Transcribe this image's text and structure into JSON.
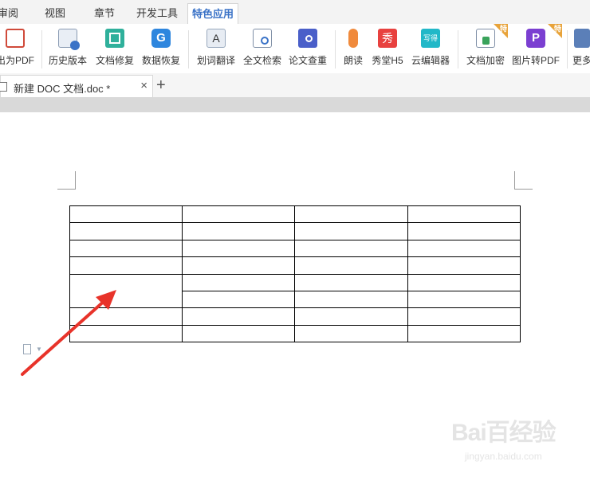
{
  "menu": {
    "tabs": [
      {
        "label": "审阅"
      },
      {
        "label": "视图"
      },
      {
        "label": "章节"
      },
      {
        "label": "开发工具"
      },
      {
        "label": "特色应用"
      }
    ],
    "active_tab": "特色应用"
  },
  "ribbon": {
    "buttons": [
      {
        "label": "出为PDF",
        "icon": "pdf-export-icon"
      },
      {
        "label": "历史版本",
        "icon": "history-icon"
      },
      {
        "label": "文档修复",
        "icon": "doc-repair-icon"
      },
      {
        "label": "数据恢复",
        "icon": "data-recovery-icon"
      },
      {
        "label": "划词翻译",
        "icon": "translate-icon"
      },
      {
        "label": "全文检索",
        "icon": "search-doc-icon"
      },
      {
        "label": "论文查重",
        "icon": "plagiarism-check-icon"
      },
      {
        "label": "朗读",
        "icon": "microphone-icon"
      },
      {
        "label": "秀堂H5",
        "icon": "xiutang-icon",
        "glyph": "秀"
      },
      {
        "label": "云编辑器",
        "icon": "cloud-editor-icon",
        "glyph": "写得"
      },
      {
        "label": "文档加密",
        "icon": "doc-encrypt-icon",
        "badge": "特"
      },
      {
        "label": "图片转PDF",
        "icon": "image-to-pdf-icon",
        "badge": "特"
      },
      {
        "label": "更多",
        "icon": "more-icon"
      }
    ]
  },
  "document_tab": {
    "title": "新建 DOC 文档.doc *",
    "close": "×",
    "add": "+"
  },
  "watermark": {
    "main": "Bai百经验",
    "sub": "jingyan.baidu.com"
  },
  "colors": {
    "accent": "#3b73c7",
    "arrow": "#e8332a",
    "ribbon_bg": "#ffffff",
    "menubar_bg": "#f3f3f3"
  }
}
